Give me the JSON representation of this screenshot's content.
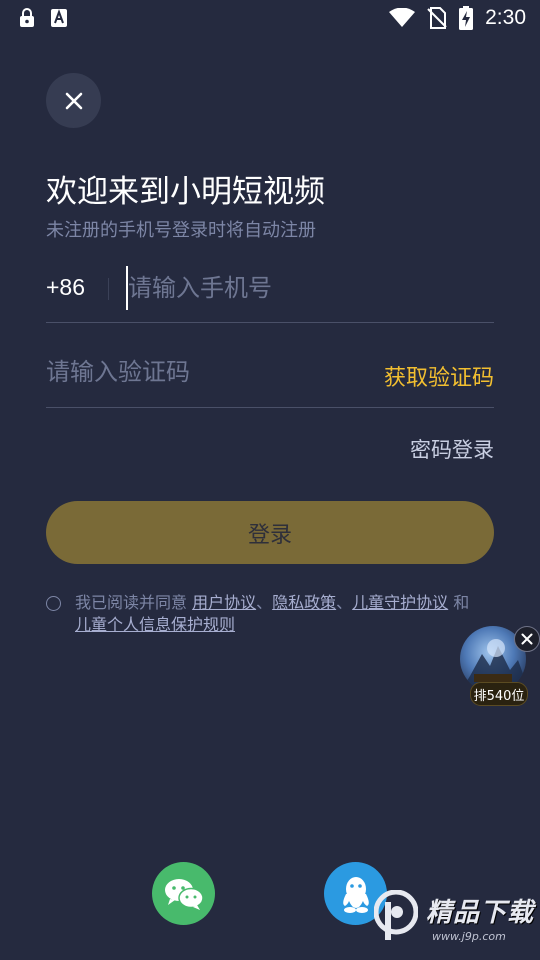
{
  "status_bar": {
    "time": "2:30",
    "left_icons": [
      "lock-icon",
      "font-a-icon"
    ],
    "right_icons": [
      "wifi-icon",
      "no-sim-icon",
      "battery-charging-icon"
    ]
  },
  "login": {
    "title": "欢迎来到小明短视频",
    "subtitle": "未注册的手机号登录时将自动注册",
    "country_code": "+86",
    "phone_placeholder": "请输入手机号",
    "code_placeholder": "请输入验证码",
    "get_code_label": "获取验证码",
    "password_login_label": "密码登录",
    "login_button_label": "登录"
  },
  "agreement": {
    "prefix": "我已阅读并同意",
    "user_agreement": "用户协议",
    "sep1": "、",
    "privacy_policy": "隐私政策",
    "sep2": "、",
    "child_protection": "儿童守护协议",
    "and": "和",
    "child_info_rules": "儿童个人信息保护规则"
  },
  "ad": {
    "badge": "排540位"
  },
  "social": [
    "wechat-icon",
    "qq-icon"
  ],
  "watermark": {
    "text": "精品下载",
    "url": "www.j9p.com"
  },
  "colors": {
    "background": "#252a3f",
    "accent": "#f2bf30",
    "login_button": "#7a6a37",
    "wechat": "#48ba6c",
    "qq": "#2b9ae1"
  }
}
